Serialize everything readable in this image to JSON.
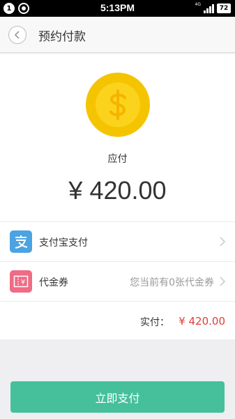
{
  "status_bar": {
    "badge": "1",
    "time": "5:13PM",
    "network": "4G",
    "battery": "72"
  },
  "nav": {
    "title": "预约付款"
  },
  "summary": {
    "payable_label": "应付",
    "amount": "¥ 420.00"
  },
  "payment_method": {
    "label": "支付宝支付",
    "icon": "alipay-icon",
    "icon_color": "#4ba3e2"
  },
  "voucher": {
    "label": "代金券",
    "value": "您当前有0张代金券",
    "icon": "voucher-icon",
    "icon_color": "#f06b85"
  },
  "total": {
    "label": "实付：",
    "amount": "¥ 420.00",
    "color": "#e03c3c"
  },
  "actions": {
    "pay_now": "立即支付",
    "color": "#45c09b"
  }
}
